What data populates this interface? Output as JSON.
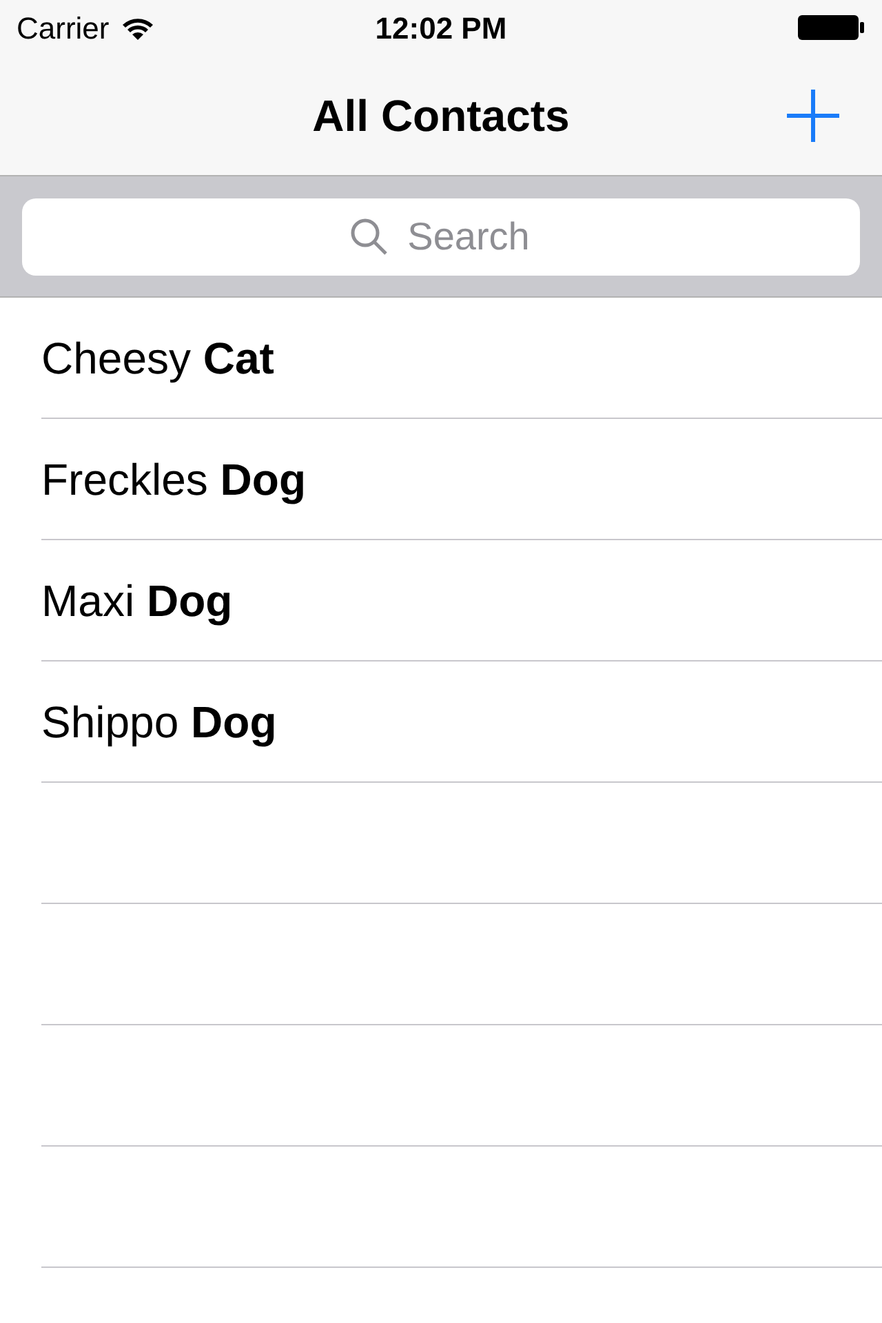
{
  "status_bar": {
    "carrier": "Carrier",
    "time": "12:02 PM"
  },
  "nav_bar": {
    "title": "All Contacts"
  },
  "search": {
    "placeholder": "Search"
  },
  "contacts": [
    {
      "name": "Cheesy **Cat**"
    },
    {
      "name": "Freckles **Dog**"
    },
    {
      "name": "Maxi **Dog**"
    },
    {
      "name": "Shippo **Dog**"
    }
  ]
}
